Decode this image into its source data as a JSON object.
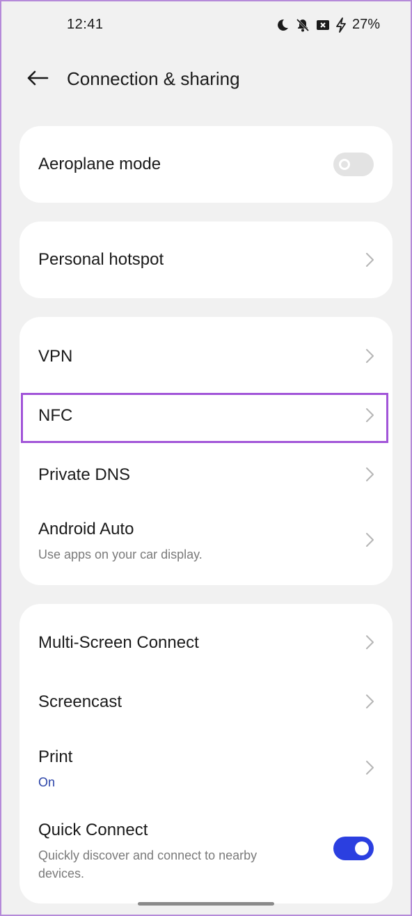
{
  "status_bar": {
    "time": "12:41",
    "battery_percent": "27%",
    "icons": [
      "moon-icon",
      "bell-off-icon",
      "no-sim-icon",
      "charging-bolt-icon"
    ]
  },
  "app_bar": {
    "title": "Connection & sharing",
    "back_icon": "back-arrow-icon"
  },
  "groups": [
    {
      "items": [
        {
          "label": "Aeroplane mode",
          "control": "toggle",
          "toggle_on": false
        }
      ]
    },
    {
      "items": [
        {
          "label": "Personal hotspot",
          "control": "chevron"
        }
      ]
    },
    {
      "items": [
        {
          "label": "VPN",
          "control": "chevron"
        },
        {
          "label": "NFC",
          "control": "chevron",
          "highlighted": true
        },
        {
          "label": "Private DNS",
          "control": "chevron"
        },
        {
          "label": "Android Auto",
          "subtitle": "Use apps on your car display.",
          "control": "chevron"
        }
      ]
    },
    {
      "items": [
        {
          "label": "Multi-Screen Connect",
          "control": "chevron"
        },
        {
          "label": "Screencast",
          "control": "chevron"
        },
        {
          "label": "Print",
          "subtitle": "On",
          "control": "chevron"
        },
        {
          "label": "Quick Connect",
          "subtitle_lines": [
            "Quickly discover and connect to nearby",
            "devices."
          ],
          "control": "toggle",
          "toggle_on": true
        }
      ]
    }
  ],
  "colors": {
    "background": "#f1f1f1",
    "card": "#ffffff",
    "accent_toggle": "#2b3fe0",
    "status_on_text": "#2a43a8",
    "highlight_border": "#a154d8"
  }
}
